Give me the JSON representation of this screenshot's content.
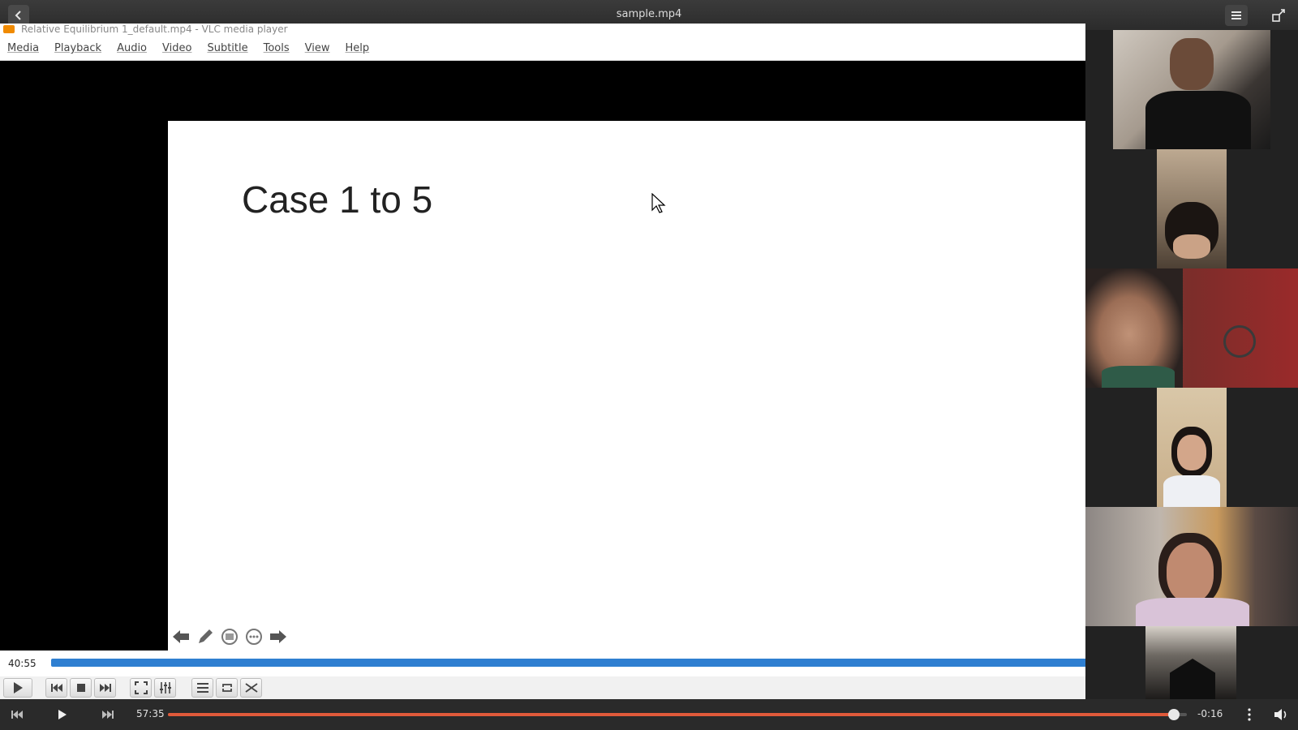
{
  "header": {
    "title": "sample.mp4",
    "back_icon": "chevron-left-icon",
    "menu_icon": "hamburger-icon",
    "restore_icon": "unmaximize-icon"
  },
  "vlc": {
    "window_title": "Relative Equilibrium 1_default.mp4 - VLC media player",
    "menu": [
      "Media",
      "Playback",
      "Audio",
      "Video",
      "Subtitle",
      "Tools",
      "View",
      "Help"
    ],
    "slide_title": "Case 1 to 5",
    "current_time": "40:55",
    "seek_progress": 1.0
  },
  "participants": {
    "count": 6
  },
  "player": {
    "elapsed": "57:35",
    "remaining": "-0:16",
    "progress": 0.987,
    "colors": {
      "accent": "#e05a3a",
      "vlc_seek": "#2f7fd1"
    }
  }
}
